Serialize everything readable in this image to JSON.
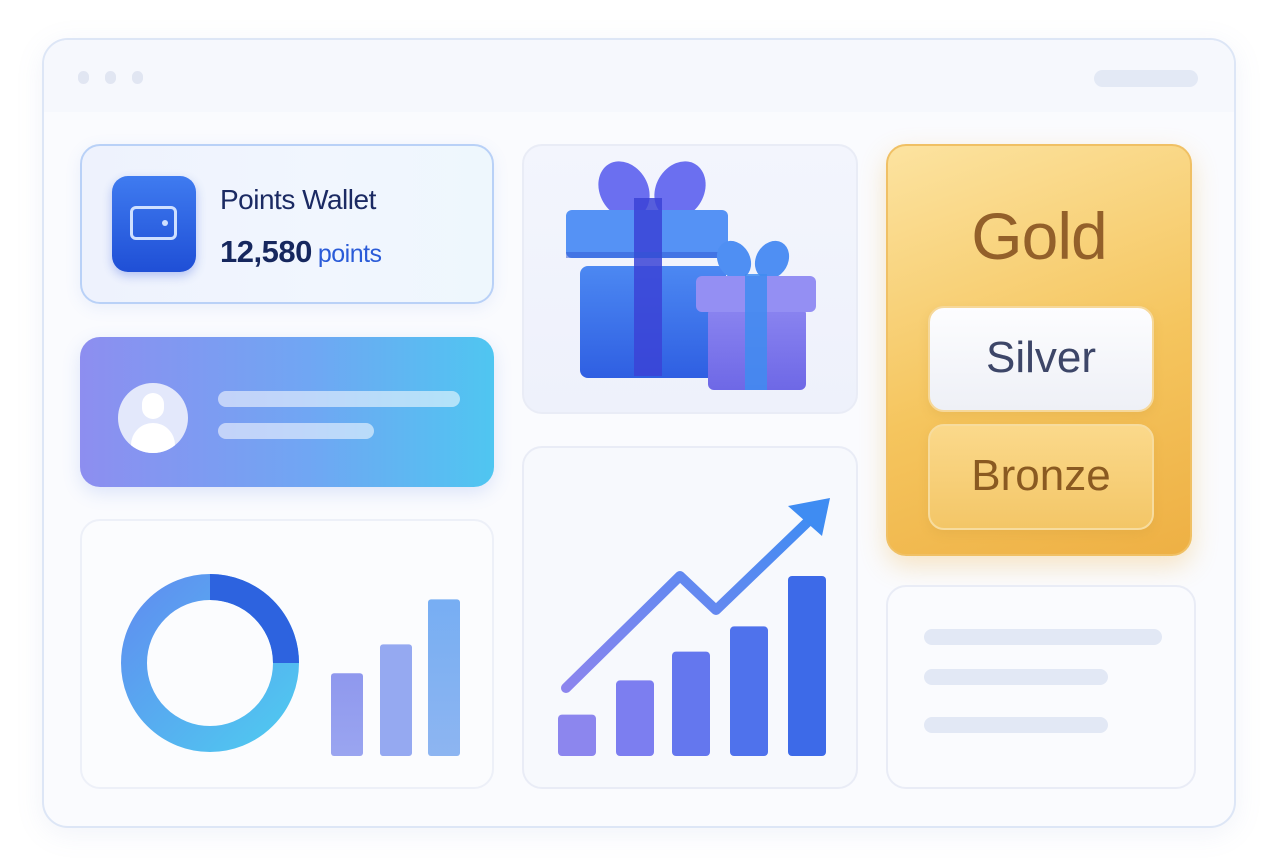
{
  "window": {
    "title": ""
  },
  "wallet": {
    "title": "Points Wallet",
    "points_value": "12,580",
    "points_unit": "points",
    "icon": "wallet-icon"
  },
  "profile": {
    "icon": "user-avatar-icon"
  },
  "gift_card": {
    "icon": "gift-boxes-icon"
  },
  "tiers": {
    "gold_label": "Gold",
    "silver_label": "Silver",
    "bronze_label": "Bronze",
    "colors": {
      "gold": "#f5c55e",
      "silver": "#f3f4f8",
      "bronze": "#f3c667"
    }
  },
  "colors": {
    "accent": "#2f6bea",
    "accent_purple": "#8a85ee",
    "accent_cyan": "#4fc6f1"
  },
  "stats": {
    "icons": [
      "donut-chart-icon",
      "bar-chart-icon"
    ],
    "donut_share": 0.25,
    "bar_levels": [
      0.46,
      0.62,
      0.87
    ]
  },
  "growth": {
    "icon": "growth-chart-icon",
    "bar_levels": [
      0.23,
      0.42,
      0.58,
      0.72,
      1.0
    ]
  }
}
